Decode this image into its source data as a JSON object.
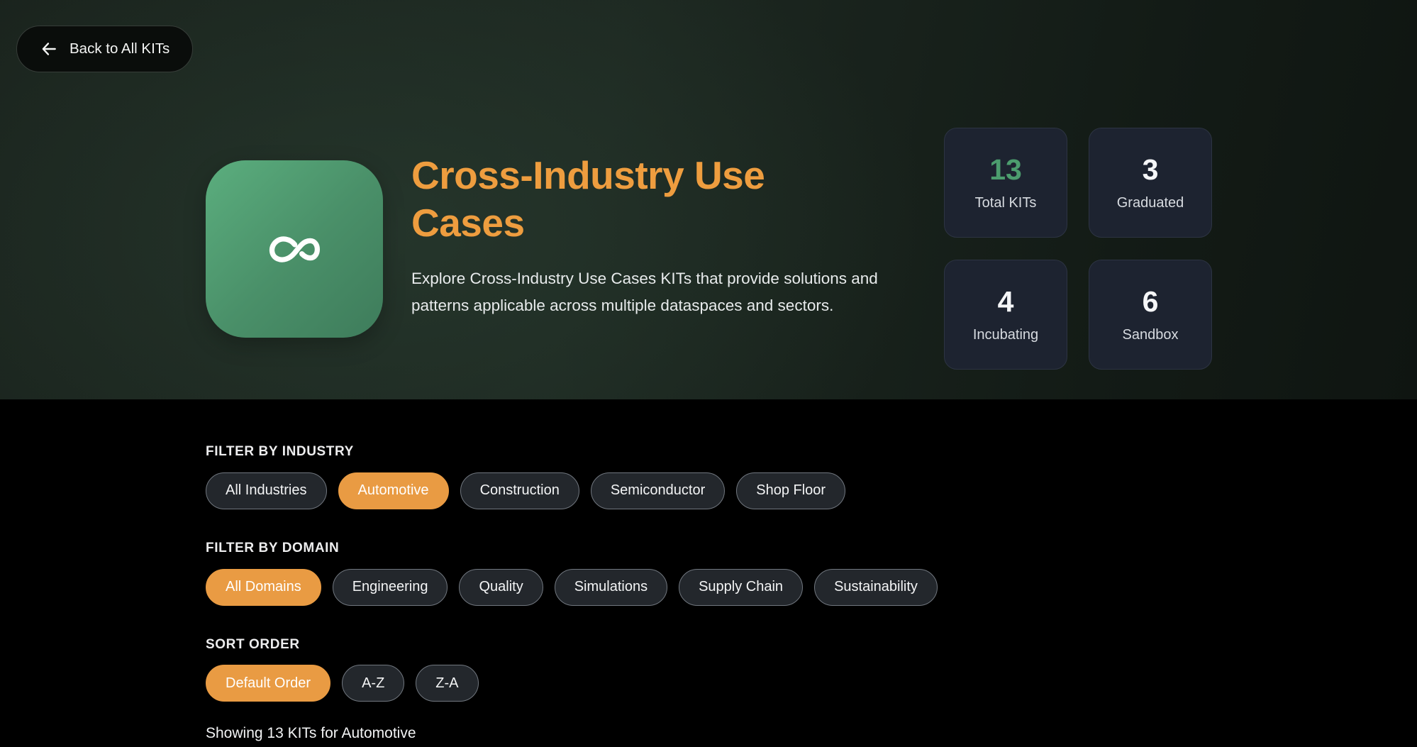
{
  "back_button": {
    "label": "Back to All KITs",
    "icon": "arrow-left"
  },
  "hero": {
    "title": "Cross-Industry Use Cases",
    "description": "Explore Cross-Industry Use Cases KITs that provide solutions and patterns applicable across multiple dataspaces and sectors.",
    "icon": "infinity"
  },
  "stats": [
    {
      "value": "13",
      "label": "Total KITs",
      "value_color": "#4c9d6e"
    },
    {
      "value": "3",
      "label": "Graduated",
      "value_color": "#f5f6f8"
    },
    {
      "value": "4",
      "label": "Incubating",
      "value_color": "#f5f6f8"
    },
    {
      "value": "6",
      "label": "Sandbox",
      "value_color": "#f5f6f8"
    }
  ],
  "filters": {
    "industry": {
      "label": "FILTER BY INDUSTRY",
      "options": [
        {
          "label": "All Industries",
          "active": false
        },
        {
          "label": "Automotive",
          "active": true
        },
        {
          "label": "Construction",
          "active": false
        },
        {
          "label": "Semiconductor",
          "active": false
        },
        {
          "label": "Shop Floor",
          "active": false
        }
      ]
    },
    "domain": {
      "label": "FILTER BY DOMAIN",
      "options": [
        {
          "label": "All Domains",
          "active": true
        },
        {
          "label": "Engineering",
          "active": false
        },
        {
          "label": "Quality",
          "active": false
        },
        {
          "label": "Simulations",
          "active": false
        },
        {
          "label": "Supply Chain",
          "active": false
        },
        {
          "label": "Sustainability",
          "active": false
        }
      ]
    },
    "sort": {
      "label": "SORT ORDER",
      "options": [
        {
          "label": "Default Order",
          "active": true
        },
        {
          "label": "A-Z",
          "active": false
        },
        {
          "label": "Z-A",
          "active": false
        }
      ]
    }
  },
  "results_summary": "Showing 13 KITs for Automotive",
  "colors": {
    "accent_orange": "#e99b43",
    "title_orange": "#ee9d3f",
    "stat_green": "#4c9d6e",
    "icon_gradient_start": "#5bae7e",
    "icon_gradient_end": "#3e7c5b",
    "card_bg": "#1d2330",
    "section_bg": "#000000"
  }
}
